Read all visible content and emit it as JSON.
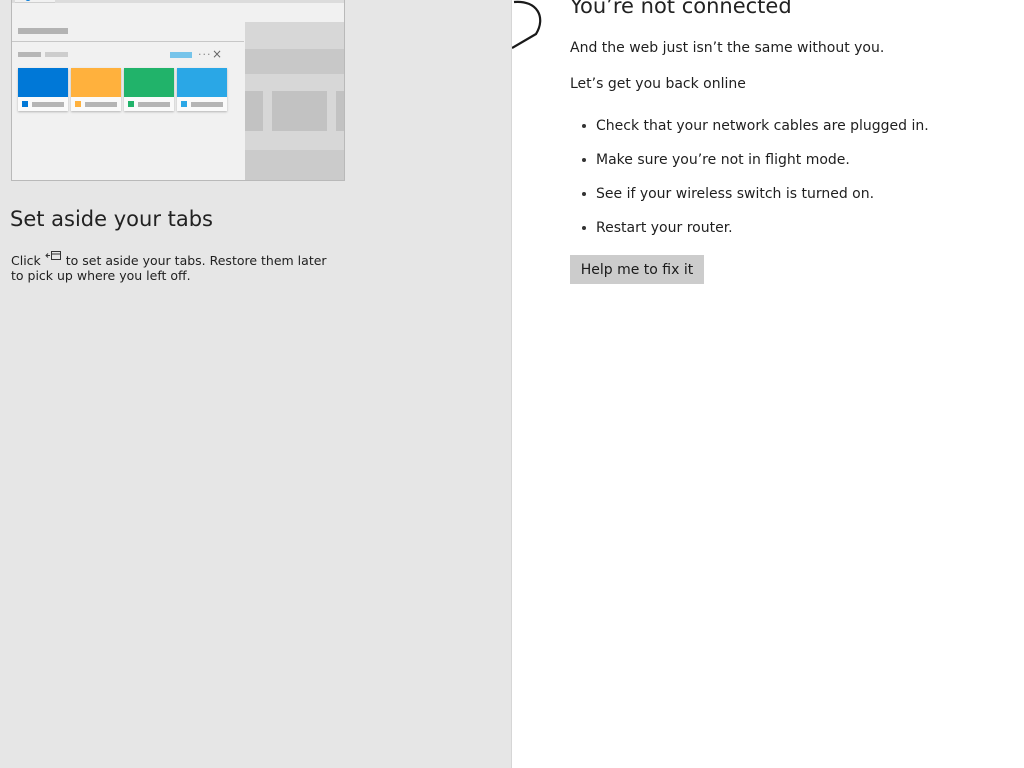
{
  "tips": {
    "title": "Set aside your tabs",
    "description_before_icon": "Click ",
    "description_after_icon": " to set aside your tabs. Restore them later to pick up where you left off.",
    "icon": "set-aside-tabs-icon",
    "illustration_icons": [
      "more-options-icon",
      "close-icon"
    ],
    "illustration_more_glyph": "...",
    "illustration_close_glyph": "×",
    "card_colors": [
      "#0078d7",
      "#ffb13d",
      "#21b36a",
      "#2aa7e6"
    ]
  },
  "error": {
    "title": "You’re not connected",
    "subtitle": "And the web just isn’t the same without you.",
    "prompt": "Let’s get you back online",
    "suggestions": [
      "Check that your network cables are plugged in.",
      "Make sure you’re not in flight mode.",
      "See if your wireless switch is turned on.",
      "Restart your router."
    ],
    "fix_button": "Help me to fix it"
  },
  "colors": {
    "left_background": "#e6e6e6",
    "right_background": "#ffffff",
    "button_background": "#cccccc",
    "accent_blue": "#0078d7"
  }
}
